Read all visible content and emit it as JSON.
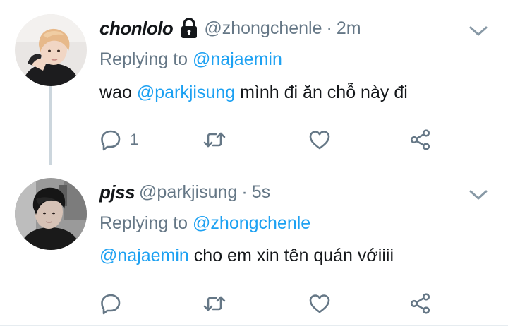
{
  "tweets": [
    {
      "display_name": "chonlolo",
      "handle": "@zhongchenle",
      "separator": "·",
      "time": "2m",
      "locked": true,
      "replying_prefix": "Replying to",
      "replying_to": "@najaemin",
      "body_prefix": "wao",
      "body_mention": "@parkjisung",
      "body_text": "mình đi ăn chỗ này đi",
      "reply_count": "1",
      "icons": [
        "reply-icon",
        "retweet-icon",
        "like-icon",
        "share-icon",
        "chevron-down-icon"
      ]
    },
    {
      "display_name": "pjss",
      "handle": "@parkjisung",
      "separator": "·",
      "time": "5s",
      "locked": false,
      "replying_prefix": "Replying to",
      "replying_to": "@zhongchenle",
      "body_mention": "@najaemin",
      "body_text": "cho em xin tên quán vớiiii",
      "reply_count": "",
      "icons": [
        "reply-icon",
        "retweet-icon",
        "like-icon",
        "share-icon",
        "chevron-down-icon"
      ]
    }
  ],
  "colors": {
    "text": "#14171a",
    "secondary": "#657786",
    "link": "#1da1f2",
    "thread_line": "#ccd6dd",
    "background": "#ffffff"
  }
}
